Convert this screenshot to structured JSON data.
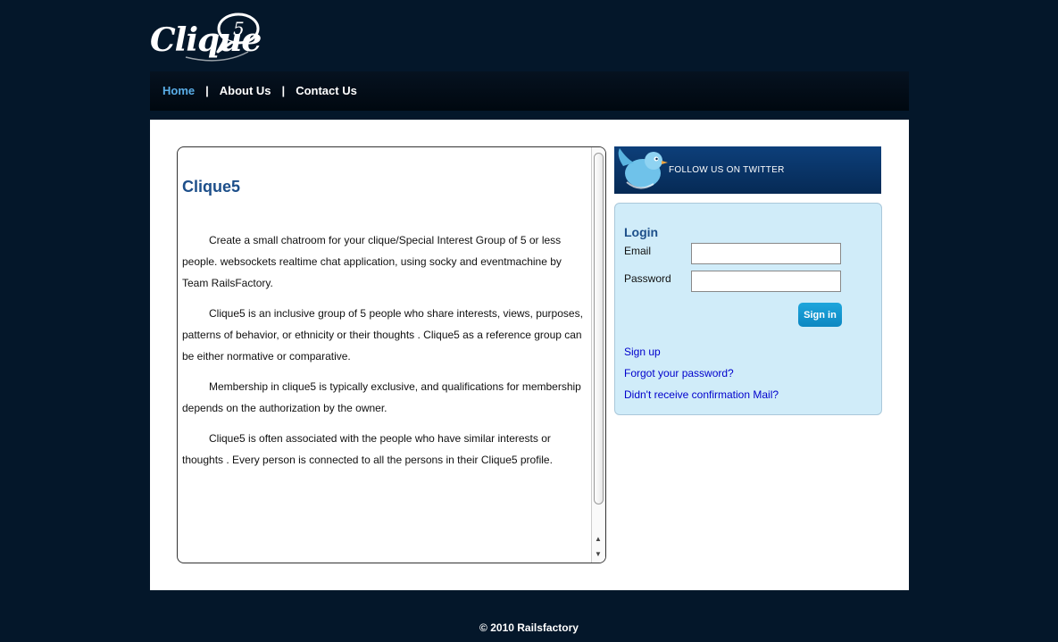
{
  "brand": {
    "logo_text": "Clique",
    "logo_bubble_number": "5"
  },
  "nav": {
    "items": [
      {
        "label": "Home"
      },
      {
        "label": "About Us"
      },
      {
        "label": "Contact Us"
      }
    ],
    "separator": "|"
  },
  "article": {
    "title": "Clique5",
    "paragraphs": [
      "Create a small chatroom for your clique/Special Interest Group of 5 or less people. websockets realtime chat application, using socky and eventmachine by Team RailsFactory.",
      "Clique5 is an inclusive group of 5 people who share interests, views, purposes, patterns of behavior, or ethnicity or their thoughts . Clique5 as a reference group can be either normative or comparative.",
      " Membership in clique5 is typically exclusive, and qualifications for membership depends on the authorization by the owner.",
      "Clique5 is often associated with the people who have similar interests or thoughts . Every person is connected to all the persons in their Clique5 profile."
    ]
  },
  "twitter": {
    "label": "FOLLOW US ON TWITTER",
    "icon": "twitter-bird-icon"
  },
  "login": {
    "title": "Login",
    "email_label": "Email",
    "email_value": "",
    "password_label": "Password",
    "password_value": "",
    "sign_in_label": "Sign in",
    "links": {
      "sign_up": "Sign up",
      "forgot_password": "Forgot your password?",
      "confirmation": "Didn't receive confirmation Mail?"
    }
  },
  "footer": {
    "text": "© 2010 Railsfactory"
  },
  "colors": {
    "page_bg": "#04172a",
    "accent_link": "#5aaee8",
    "title_blue": "#1d4f8a",
    "login_bg": "#d0ecf9",
    "button_blue": "#1499d0"
  }
}
